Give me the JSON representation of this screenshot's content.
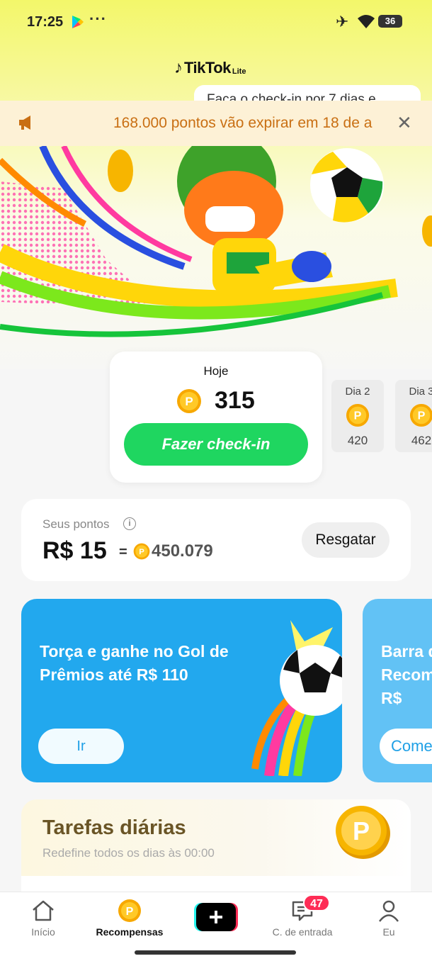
{
  "status_bar": {
    "time": "17:25",
    "menu_dots": "···",
    "battery": "36"
  },
  "app": {
    "logo_main": "TikTok",
    "logo_sub": "Lite"
  },
  "tooltip": {
    "text": "Faça o check-in por 7 dias e"
  },
  "banner": {
    "text": "168.000 pontos vão expirar em 18 de a",
    "close": "✕"
  },
  "checkin": {
    "today_label": "Hoje",
    "today_points": "315",
    "button_label": "Fazer check-in",
    "days": [
      {
        "label": "Dia 2",
        "value": "420"
      },
      {
        "label": "Dia 3",
        "value": "462"
      }
    ]
  },
  "points": {
    "label": "Seus pontos",
    "info": "i",
    "money": "R$ 15",
    "equals": "=",
    "value": "450.079",
    "redeem_label": "Resgatar"
  },
  "promos": [
    {
      "title": "Torça e ganhe no Gol de Prêmios até R$ 110",
      "button": "Ir"
    },
    {
      "title": "Barra de Recompensas até R$",
      "button": "Começar"
    }
  ],
  "tasks": {
    "title": "Tarefas diárias",
    "subtitle": "Redefine todos os dias às 00:00"
  },
  "nav": {
    "items": [
      {
        "label": "Início"
      },
      {
        "label": "Recompensas"
      },
      {
        "label": "C. de entrada"
      },
      {
        "label": "Eu"
      }
    ],
    "inbox_badge": "47"
  },
  "coin_letter": "P",
  "colors": {
    "accent_green": "#1fd660",
    "promo_blue": "#22a8ee",
    "banner_text": "#c96f13",
    "badge_red": "#fe2c55"
  },
  "icons": [
    "google-play-icon",
    "airplane-icon",
    "wifi-icon",
    "megaphone-icon",
    "close-icon",
    "coin-icon",
    "info-icon",
    "home-icon",
    "rewards-icon",
    "create-icon",
    "inbox-icon",
    "profile-icon"
  ]
}
